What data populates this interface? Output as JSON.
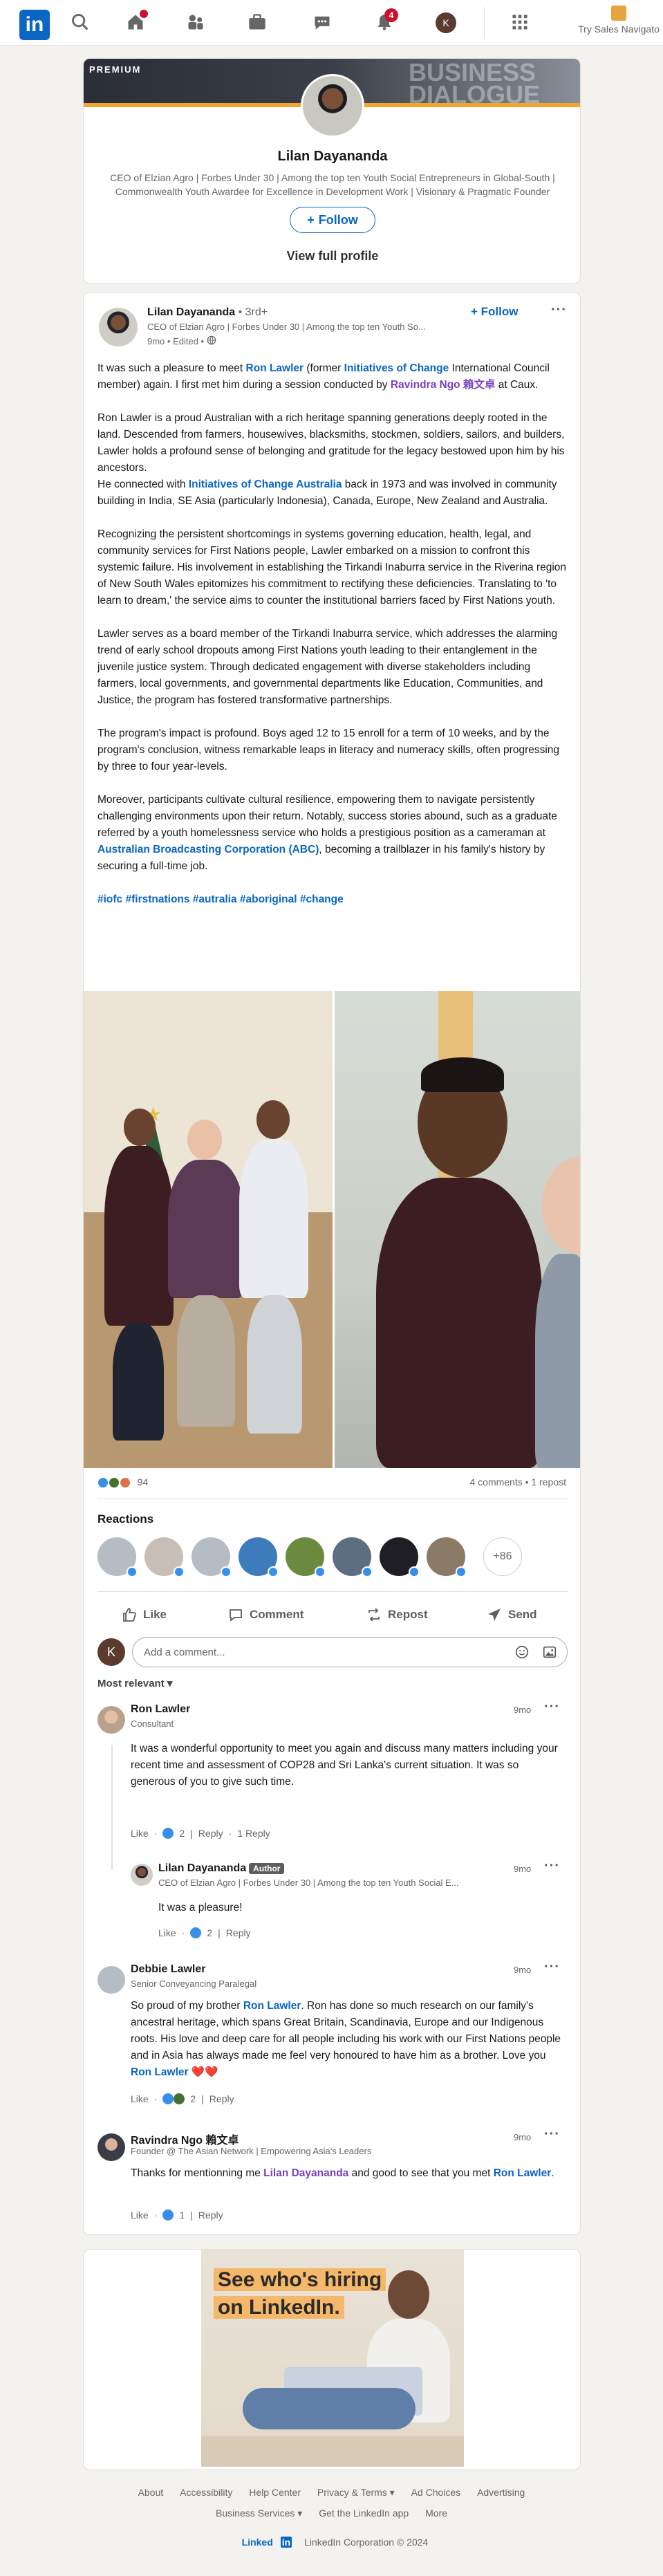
{
  "nav": {
    "logo_text": "in",
    "notifications_badge": "4",
    "me_initial": "K",
    "premium_label": "Try Sales Navigato",
    "icons": [
      "search-icon",
      "home-icon",
      "network-icon",
      "jobs-icon",
      "messaging-icon",
      "notifications-icon",
      "grid-icon"
    ]
  },
  "profile_card": {
    "banner_tag": "PREMIUM",
    "banner_text_1": "BUSINESS",
    "banner_text_2": "DIALOGUE",
    "name": "Lilan Dayananda",
    "headline": "CEO of Elzian Agro | Forbes Under 30 | Among the top ten Youth Social Entrepreneurs in Global-South | Commonwealth Youth Awardee for Excellence in Development Work | Visionary & Pragmatic Founder",
    "follow_label": "Follow",
    "view_profile_label": "View full profile"
  },
  "post": {
    "author": "Lilan Dayananda",
    "degree": " • 3rd+",
    "headline": "CEO of Elzian Agro | Forbes Under 30 | Among the top ten Youth So...",
    "meta": "9mo • Edited •",
    "follow_label": "Follow",
    "p1_a": "It was such a pleasure to meet ",
    "p1_link1": "Ron Lawler",
    "p1_b": " (former ",
    "p1_link2": "Initiatives of Change",
    "p1_c": " International Council member) again. I first met him during a session conducted by ",
    "p1_link3": "Ravindra Ngo 賴文卓",
    "p1_d": " at Caux.",
    "p2_a": "Ron Lawler is a proud Australian with a rich heritage spanning generations deeply rooted in the land. Descended from farmers, housewives, blacksmiths, stockmen, soldiers, sailors, and builders, Lawler holds a profound sense of belonging and gratitude for the legacy bestowed upon him by his ancestors.",
    "p2_b": "He connected with ",
    "p2_link": "Initiatives of Change Australia",
    "p2_c": " back in 1973 and was involved in community building in India, SE Asia (particularly Indonesia), Canada, Europe, New Zealand and Australia.",
    "p3": "Recognizing the persistent shortcomings in systems governing education, health, legal, and community services for First Nations people, Lawler embarked on a mission to confront this systemic failure. His involvement in establishing the Tirkandi Inaburra service in the Riverina region of New South Wales epitomizes his commitment to rectifying these deficiencies. Translating to 'to learn to dream,' the service aims to counter the institutional barriers faced by First Nations youth.",
    "p4": "Lawler serves as a board member of the Tirkandi Inaburra service, which addresses the alarming trend of early school dropouts among First Nations youth leading to their entanglement in the juvenile justice system. Through dedicated engagement with diverse stakeholders including farmers, local governments, and governmental departments like Education, Communities, and Justice, the program has fostered transformative partnerships.",
    "p5": "The program's impact is profound. Boys aged 12 to 15 enroll for a term of 10 weeks, and by the program's conclusion, witness remarkable leaps in literacy and numeracy skills, often progressing by three to four year-levels.",
    "p6_a": "Moreover, participants cultivate cultural resilience, empowering them to navigate persistently challenging environments upon their return. Notably, success stories abound, such as a graduate referred by a youth homelessness service who holds a prestigious position as a cameraman at ",
    "p6_link": "Australian Broadcasting Corporation (ABC)",
    "p6_b": ", becoming a trailblazer in his family's history by securing a full-time job.",
    "hashtags": "#iofc #firstnations #autralia #aboriginal #change",
    "reactions_count": "94",
    "comments_summary": "4 comments • 1 repost",
    "reactions_title": "Reactions",
    "more_reactors": "+86",
    "actions": {
      "like": "Like",
      "comment": "Comment",
      "repost": "Repost",
      "send": "Send"
    }
  },
  "comment_box": {
    "placeholder": "Add a comment...",
    "sort": "Most relevant"
  },
  "comments": [
    {
      "name": "Ron Lawler",
      "sub": "Consultant",
      "time": "9mo",
      "text": "It was a wonderful opportunity to meet you again and discuss many matters including your recent time and assessment of COP28 and Sri Lanka's current situation. It was so generous of you to give such time.",
      "like": "Like",
      "likes": "2",
      "reply": "Reply",
      "replies": "1 Reply"
    },
    {
      "name": "Lilan Dayananda",
      "badge": "Author",
      "sub": "CEO of Elzian Agro | Forbes Under 30 | Among the top ten Youth Social E...",
      "time": "9mo",
      "text": "It was a pleasure!",
      "like": "Like",
      "likes": "2",
      "reply": "Reply"
    },
    {
      "name": "Debbie Lawler",
      "sub": "Senior Conveyancing Paralegal",
      "time": "9mo",
      "text_a": "So proud of my brother ",
      "text_link1": "Ron Lawler",
      "text_b": ". Ron has done so much research on our family's ancestral heritage, which spans Great Britain, Scandinavia, Europe and our Indigenous roots. His love and deep care for all people including his work with our First Nations people and in Asia has always made me feel very honoured to have him as a brother. Love you ",
      "text_link2": "Ron Lawler",
      "text_c": " ❤️❤️",
      "like": "Like",
      "likes": "2",
      "reply": "Reply"
    },
    {
      "name": "Ravindra Ngo 賴文卓",
      "sub": "Founder @ The Asian Network | Empowering Asia's Leaders",
      "time": "9mo",
      "text_a": "Thanks for mentionning me ",
      "text_link1": "Lilan Dayananda",
      "text_b": " and good to see that you met ",
      "text_link2": "Ron Lawler",
      "text_c": ".",
      "like": "Like",
      "likes": "1",
      "reply": "Reply"
    }
  ],
  "ad": {
    "line1": "See who's hiring",
    "line2": "on LinkedIn."
  },
  "footer": {
    "row1": [
      "About",
      "Accessibility",
      "Help Center",
      "Privacy & Terms ▾",
      "Ad Choices",
      "Advertising"
    ],
    "row2": [
      "Business Services ▾",
      "Get the LinkedIn app",
      "More"
    ],
    "brand": "Linked",
    "copyright": "LinkedIn Corporation © 2024"
  },
  "colors": {
    "brand_blue": "#0a66c2",
    "premium_gold": "#f0a530",
    "badge_red": "#cb112d"
  }
}
